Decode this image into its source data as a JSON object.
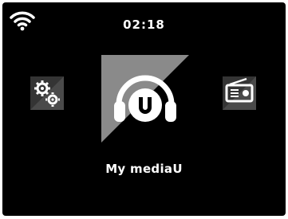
{
  "status_bar": {
    "time": "02:18",
    "wifi_icon": "wifi-icon"
  },
  "menu": {
    "items": [
      {
        "name": "settings",
        "icon": "gears-icon"
      },
      {
        "name": "my-mediau",
        "icon": "mediau-headphones-icon"
      },
      {
        "name": "radio",
        "icon": "radio-icon"
      }
    ],
    "selected_label": "My mediaU"
  },
  "colors": {
    "screen_background": "#000000",
    "tile_background": "#343434",
    "selected_tile_background": "#7a7a7a",
    "text": "#ffffff"
  }
}
